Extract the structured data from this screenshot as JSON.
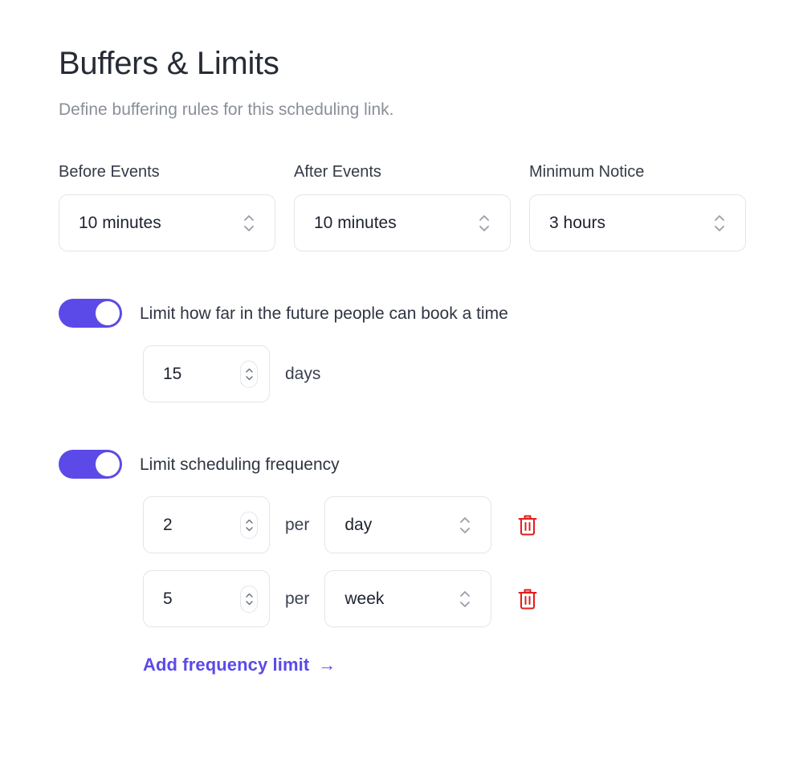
{
  "header": {
    "title": "Buffers & Limits",
    "subtitle": "Define buffering rules for this scheduling link."
  },
  "buffers": [
    {
      "label": "Before Events",
      "value": "10 minutes",
      "stepper_icon": "chevron-up-down-icon"
    },
    {
      "label": "After Events",
      "value": "10 minutes",
      "stepper_icon": "chevron-up-down-icon"
    },
    {
      "label": "Minimum Notice",
      "value": "3 hours",
      "stepper_icon": "chevron-up-down-icon"
    }
  ],
  "future_limit": {
    "toggle_state": "on",
    "label": "Limit how far in the future people can book a time",
    "amount": "15",
    "unit": "days"
  },
  "frequency_limit": {
    "toggle_state": "on",
    "label": "Limit scheduling frequency",
    "per_word": "per",
    "rows": [
      {
        "amount": "2",
        "period": "day",
        "delete_icon": "trash-icon"
      },
      {
        "amount": "5",
        "period": "week",
        "delete_icon": "trash-icon"
      }
    ],
    "add_link_label": "Add frequency limit",
    "add_link_arrow": "→"
  },
  "colors": {
    "accent": "#5b4ae8",
    "danger": "#e51b1b",
    "text_primary": "#2f3542",
    "text_muted": "#8a8f98",
    "border": "#e3e5ea",
    "background": "#ffffff"
  }
}
